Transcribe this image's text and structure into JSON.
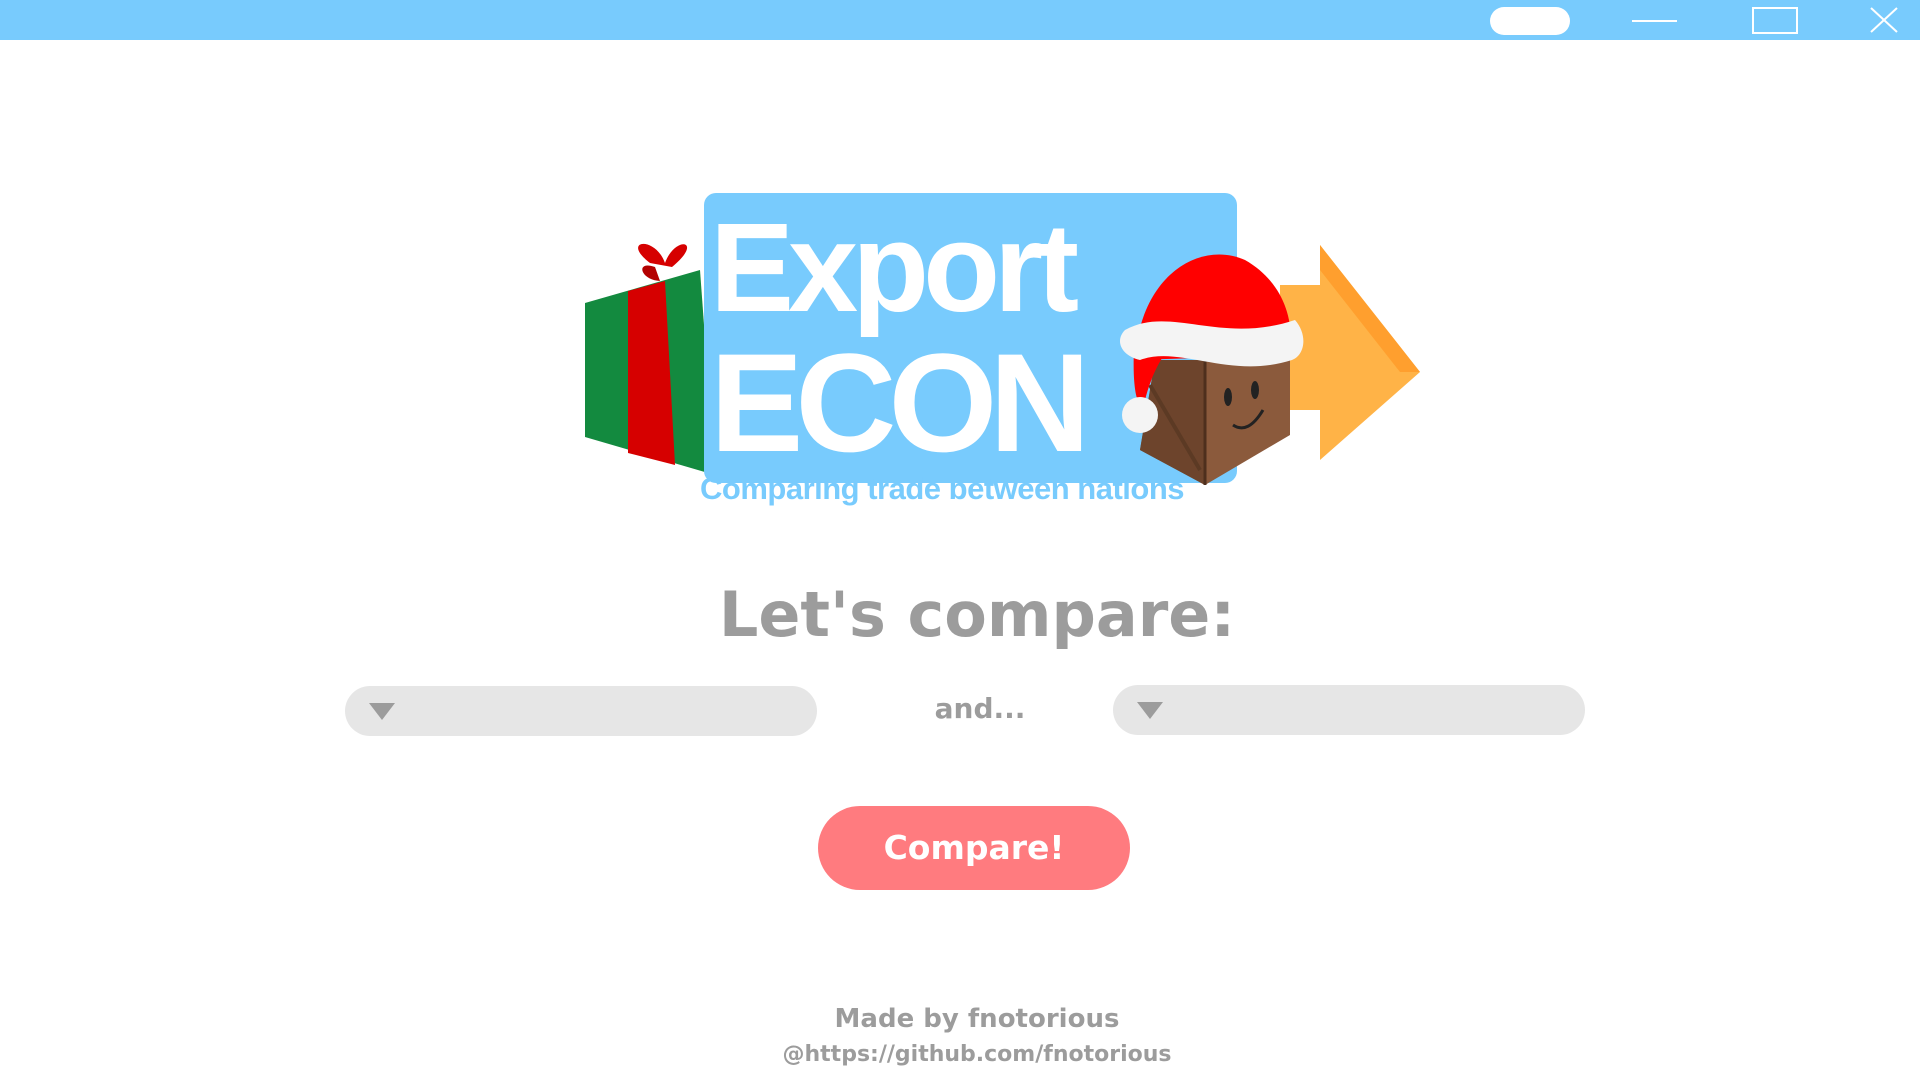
{
  "window": {
    "icons": {
      "pill": "pill-button",
      "minimize": "minimize-icon",
      "maximize": "maximize-icon",
      "close": "close-icon"
    }
  },
  "logo": {
    "word1": "Export",
    "word2": "ECON",
    "tagline": "Comparing trade between nations",
    "colors": {
      "panel": "#78cbfd",
      "gift_green": "#138a3f",
      "gift_red": "#d60000",
      "hat_red": "#ff0000",
      "crate": "#8b5a3c",
      "arrow": "#ffb347"
    }
  },
  "main": {
    "heading": "Let's compare:",
    "left_select": {
      "value": ""
    },
    "and_label": "and...",
    "right_select": {
      "value": ""
    },
    "compare_button": "Compare!"
  },
  "footer": {
    "author": "Made by fnotorious",
    "link": "@https://github.com/fnotorious"
  },
  "colors": {
    "titlebar": "#78cbfd",
    "button": "#ff7b7f",
    "text_gray": "#9c9c9c",
    "select_bg": "#e6e6e6"
  }
}
